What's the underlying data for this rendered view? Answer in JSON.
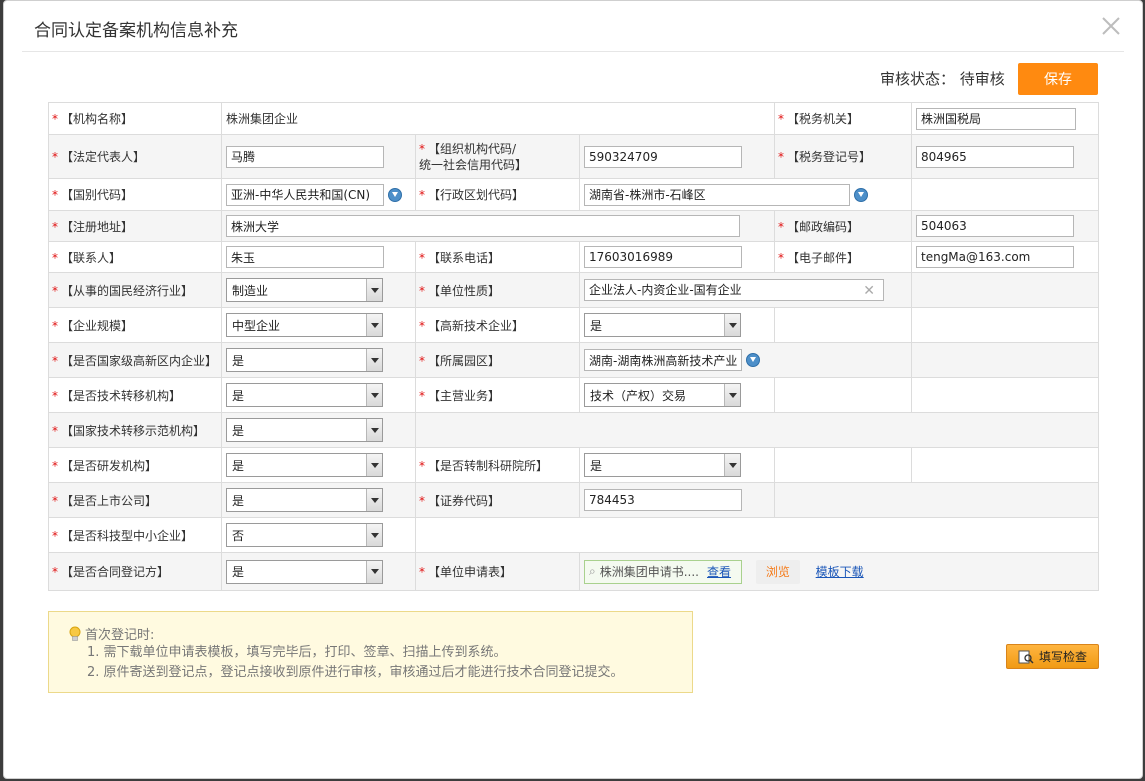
{
  "dialog": {
    "title": "合同认定备案机构信息补充",
    "status_label": "审核状态：",
    "status_value": "待审核",
    "save_label": "保存"
  },
  "rows": {
    "r1": {
      "l1": "【机构名称】",
      "v1": "株洲集团企业",
      "l2": "【税务机关】",
      "v2": "株洲国税局"
    },
    "r2": {
      "l1": "【法定代表人】",
      "v1": "马腾",
      "l2a": "【组织机构代码/",
      "l2b": "统一社会信用代码】",
      "v2": "590324709",
      "l3": "【税务登记号】",
      "v3": "804965"
    },
    "r3": {
      "l1": "【国别代码】",
      "v1": "亚洲-中华人民共和国(CN)",
      "l2": "【行政区划代码】",
      "v2": "湖南省-株洲市-石峰区"
    },
    "r4": {
      "l1": "【注册地址】",
      "v1": "株洲大学",
      "l2": "【邮政编码】",
      "v2": "504063"
    },
    "r5": {
      "l1": "【联系人】",
      "v1": "朱玉",
      "l2": "【联系电话】",
      "v2": "17603016989",
      "l3": "【电子邮件】",
      "v3": "tengMa@163.com"
    },
    "r6": {
      "l1": "【从事的国民经济行业】",
      "v1": "制造业",
      "l2": "【单位性质】",
      "v2": "企业法人-内资企业-国有企业"
    },
    "r7": {
      "l1": "【企业规模】",
      "v1": "中型企业",
      "l2": "【高新技术企业】",
      "v2": "是"
    },
    "r8": {
      "l1": "【是否国家级高新区内企业】",
      "v1": "是",
      "l2": "【所属园区】",
      "v2": "湖南-湖南株洲高新技术产业"
    },
    "r9": {
      "l1": "【是否技术转移机构】",
      "v1": "是",
      "l2": "【主营业务】",
      "v2": "技术（产权）交易"
    },
    "r10": {
      "l1": "【国家技术转移示范机构】",
      "v1": "是"
    },
    "r11": {
      "l1": "【是否研发机构】",
      "v1": "是",
      "l2": "【是否转制科研院所】",
      "v2": "是"
    },
    "r12": {
      "l1": "【是否上市公司】",
      "v1": "是",
      "l2": "【证券代码】",
      "v2": "784453"
    },
    "r13": {
      "l1": "【是否科技型中小企业】",
      "v1": "否"
    },
    "r14": {
      "l1": "【是否合同登记方】",
      "v1": "是",
      "l2": "【单位申请表】",
      "file": "株洲集团申请书....",
      "view": "查看",
      "browse": "浏览",
      "download": "模板下载"
    }
  },
  "notice": {
    "head": "首次登记时:",
    "item1": "1. 需下载单位申请表模板，填写完毕后，打印、签章、扫描上传到系统。",
    "item2": "2. 原件寄送到登记点，登记点接收到原件进行审核，审核通过后才能进行技术合同登记提交。"
  },
  "check_label": "填写检查",
  "required_mark": "*",
  "colors": {
    "save": "#ff8a10",
    "required": "#e01010",
    "link": "#1a56b8"
  }
}
